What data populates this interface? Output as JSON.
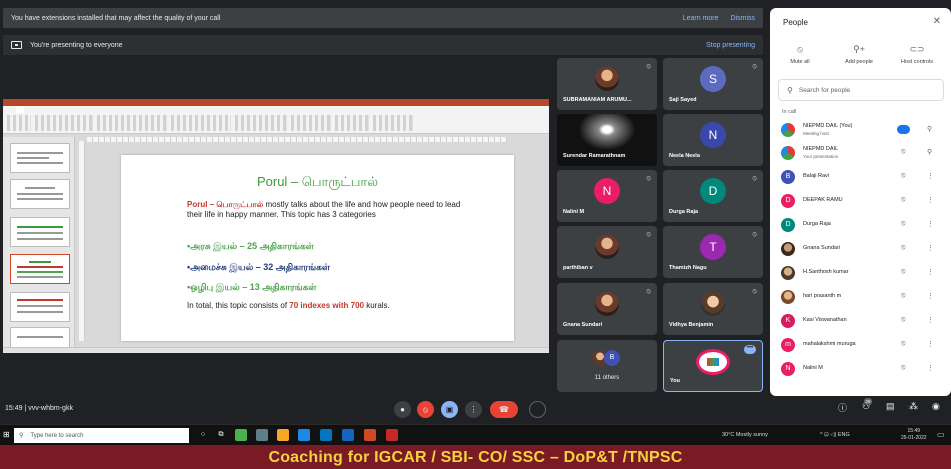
{
  "banners": {
    "extensions_text": "You have extensions installed that may affect the quality of your call",
    "learn_more": "Learn more",
    "dismiss": "Dismiss",
    "presenting_text": "You're presenting to everyone",
    "stop_presenting": "Stop presenting"
  },
  "slide": {
    "title": "Porul – பொருட்பால்",
    "intro_red": "Porul – பொருட்பால்",
    "intro_rest": " mostly talks about the life and how people need to lead their life in happy manner. This topic has 3 categories",
    "category_1": "•அரசு இயல் – 25 அதிகாரங்கள்",
    "category_2": "•அமைச்சு இயல் – 32 அதிகாரங்கள்",
    "category_3": "•ஒழிபு இயல் – 13 அதிகாரங்கள்",
    "total_pre": "In total, this topic consists of ",
    "total_red": "70 indexes with 700",
    "total_post": " kurals."
  },
  "tiles": [
    {
      "name": "SUBRAMANIAM ARUMU..."
    },
    {
      "name": "Saji Sayed",
      "initial": "S",
      "color": "#5c6bc0"
    },
    {
      "name": "Surendar Ramarathnam"
    },
    {
      "name": "Neela Neela",
      "initial": "N",
      "color": "#3949ab"
    },
    {
      "name": "Nalini M",
      "initial": "N",
      "color": "#e91e63"
    },
    {
      "name": "Durga Raja",
      "initial": "D",
      "color": "#00897b"
    },
    {
      "name": "parthiban v"
    },
    {
      "name": "Thamizh Nagu",
      "initial": "T",
      "color": "#9c27b0"
    },
    {
      "name": "Gnana Sundari"
    },
    {
      "name": "Vidhya Benjamin"
    },
    {
      "count": "11 others",
      "initial": "B"
    },
    {
      "name": "You"
    }
  ],
  "people": {
    "title": "People",
    "mute_all": "Mute all",
    "add_people": "Add people",
    "host_controls": "Host controls",
    "search_placeholder": "Search for people",
    "in_call": "In call",
    "list": [
      {
        "name": "NIEPMD DAIL (You)",
        "sub": "Meeting host"
      },
      {
        "name": "NIEPMD DAIL",
        "sub": "Your presentation"
      },
      {
        "name": "Balaji Ravi",
        "initial": "B",
        "color": "#3f51b5"
      },
      {
        "name": "DEEPAK RAMU",
        "initial": "D",
        "color": "#e91e63"
      },
      {
        "name": "Durga Raja",
        "initial": "D",
        "color": "#00897b"
      },
      {
        "name": "Gnana Sundari"
      },
      {
        "name": "H.Santhosh kumar"
      },
      {
        "name": "hari prasanth m"
      },
      {
        "name": "Kasi Viswanathan",
        "initial": "K",
        "color": "#d81b60"
      },
      {
        "name": "mahalakshmi muruga",
        "initial": "m",
        "color": "#e91e63"
      },
      {
        "name": "Nalini M",
        "initial": "N",
        "color": "#e91e63"
      }
    ]
  },
  "meet": {
    "time_code": "15:49 | vvv-whbm-gkk",
    "people_count": "29"
  },
  "taskbar": {
    "search_placeholder": "Type here to search",
    "weather": "30°C Mostly sunny",
    "lang": "ENG",
    "time": "15:49",
    "date": "25-01-2022"
  },
  "caption": "Coaching for IGCAR / SBI- CO/ SSC – DoP&T /TNPSC"
}
